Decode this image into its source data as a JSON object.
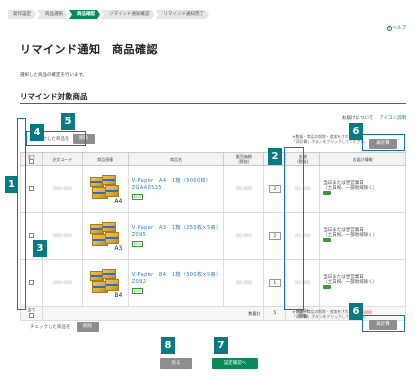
{
  "steps": [
    "発作設定",
    "商品選択",
    "商品確認",
    "リマインド通知確認",
    "リマインド通知完了"
  ],
  "active_step": 2,
  "help": {
    "label": "ヘルプ"
  },
  "page_title": "リマインド通知　商品確認",
  "intro": "選択した商品の確定を行います。",
  "section_title": "リマインド対象商品",
  "top_links": {
    "link1": "お届けについて",
    "link2": "アイコン説明"
  },
  "delete_top": {
    "label": "チェックした商品を",
    "button": "削除"
  },
  "note_top": "※数量・商品の削除・追加をされた場合\n「再計算」ボタンをクリックしてください。",
  "note_bottom": "※数量・商品の削除・追加をされた場合\n「再計算」ボタンをクリックしてください。",
  "recalc_label": "再計算",
  "table": {
    "headers": [
      "全て",
      "注文コード",
      "商品画像",
      "商品名",
      "販売価格\n(税抜)",
      "数量",
      "金額\n(税抜)",
      "お届け情報"
    ],
    "rows": [
      {
        "code": "000-000",
        "name": "V-Paper　A4　1箱（5000枚）ZGAA0535",
        "size": "A4",
        "price": "00,000",
        "qty": "2",
        "amount": "00,000",
        "delivery": "当日または翌営業日\n（土日祝、一部地域除く）"
      },
      {
        "code": "000-000",
        "name": "V-Paper　A3　1箱（250枚×5冊）Z095",
        "size": "A3",
        "price": "00,000",
        "qty": "2",
        "amount": "00,000",
        "delivery": "当日または翌営業日\n（土日祝、一部地域除く）"
      },
      {
        "code": "000-000",
        "name": "V-Paper　B4　1箱（500枚×5冊）Z092",
        "size": "B4",
        "price": "00,000",
        "qty": "1",
        "amount": "00,000",
        "delivery": "当日または翌営業日\n（土日祝、一部地域除く）"
      }
    ],
    "footer": {
      "all_label": "全て",
      "qty_total_label": "数量計",
      "qty_total": "5",
      "amount_label": "金額計\n(税抜)",
      "amount_total": "000,000"
    },
    "eco_label": "ECO"
  },
  "delete_bottom": {
    "label": "チェックした商品を",
    "button": "削除"
  },
  "buttons": {
    "back": "戻る",
    "next": "設定確認へ"
  },
  "callouts": [
    "1",
    "2",
    "3",
    "4",
    "5",
    "6",
    "6",
    "7",
    "8"
  ],
  "colors": {
    "accent": "#0a8a58",
    "callout": "#0a7a82",
    "frame": "#1a6fc0"
  }
}
